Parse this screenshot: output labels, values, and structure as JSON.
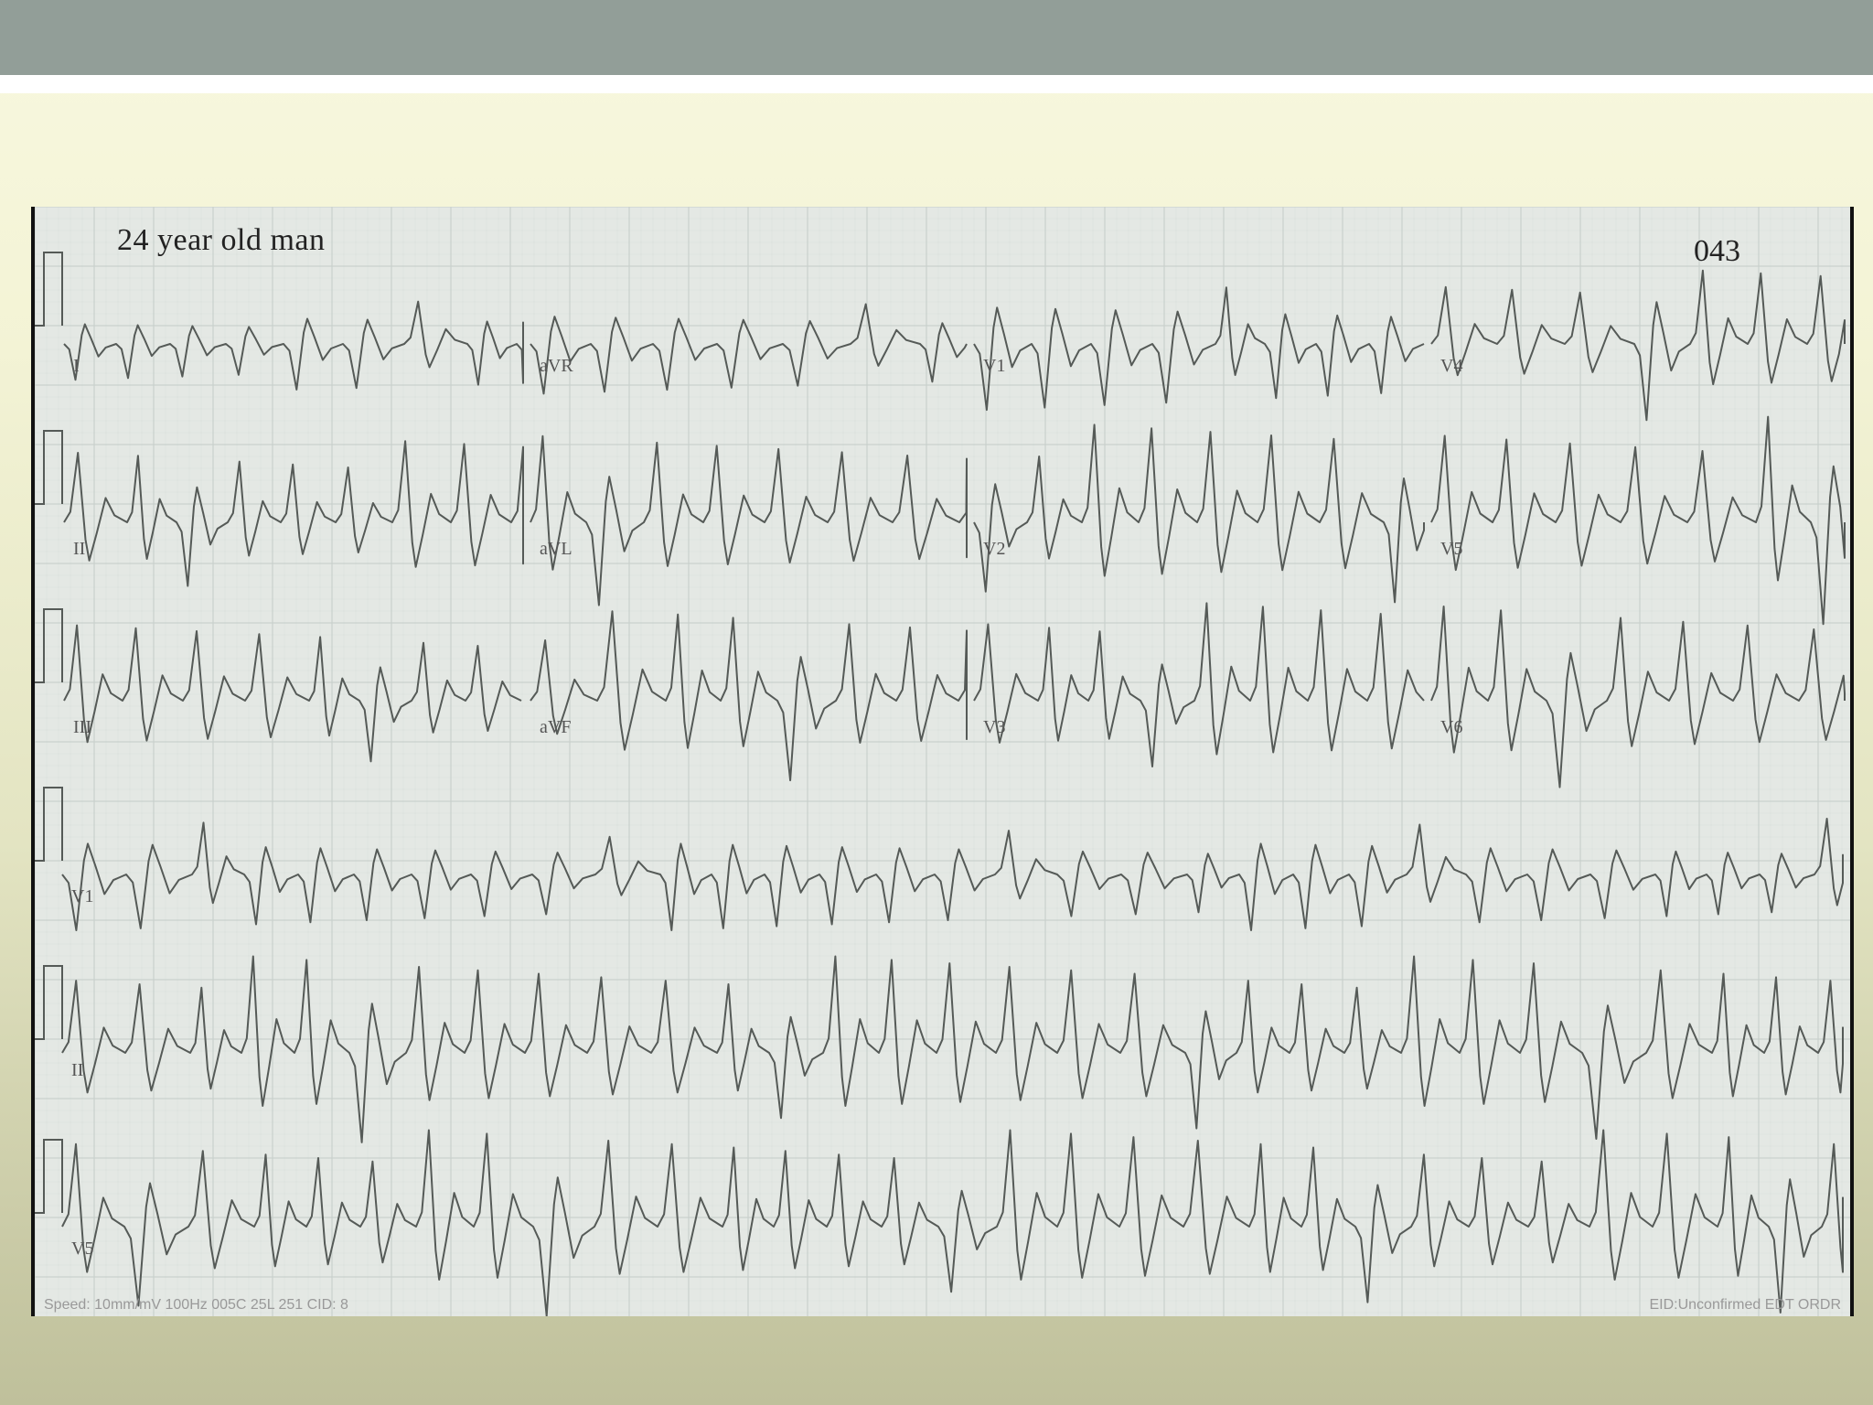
{
  "slide": {
    "colors": {
      "top_bar": "#929e98",
      "paper": "#e4e8e4",
      "trace": "#555a57",
      "grid": "#c7cfcb"
    }
  },
  "ecg": {
    "title": "24 year old man",
    "id": "043",
    "rows": [
      [
        "I",
        "aVR",
        "V1",
        "V4"
      ],
      [
        "II",
        "aVL",
        "V2",
        "V5"
      ],
      [
        "III",
        "aVF",
        "V3",
        "V6"
      ],
      [
        "V1"
      ],
      [
        "II"
      ],
      [
        "V5"
      ]
    ],
    "footer_left": [
      "Speed:",
      "10mm/mV",
      "100Hz",
      "005C",
      "25L 251",
      "CID: 8"
    ],
    "footer_right": "EID:Unconfirmed EDT ORDR"
  }
}
